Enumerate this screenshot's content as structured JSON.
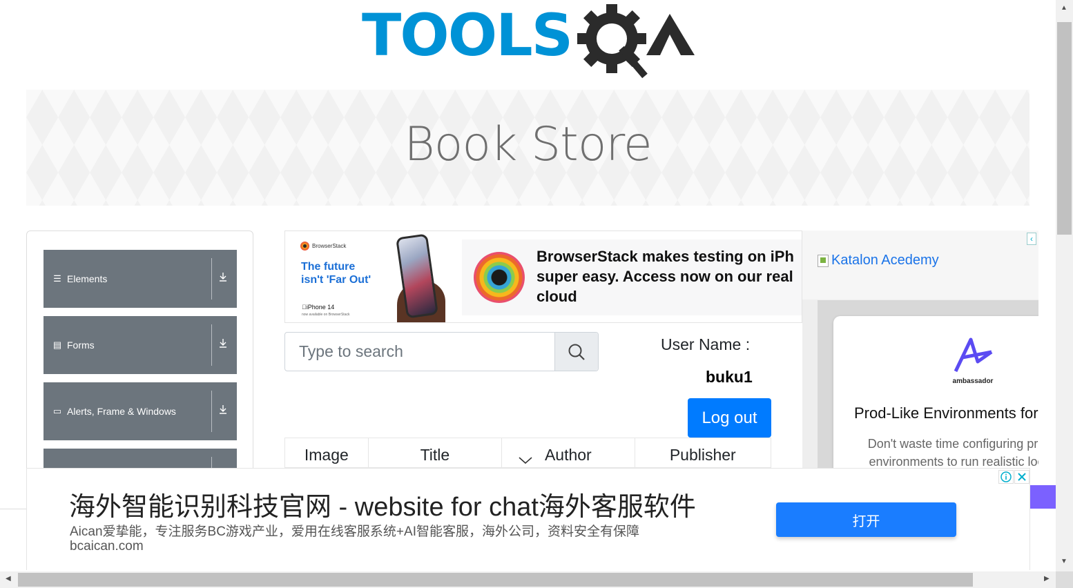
{
  "logo": {
    "text_main": "TOOLS",
    "text_q": "Q",
    "text_a": "A",
    "colors": {
      "blue": "#0092d6",
      "dark": "#2b2b2b"
    }
  },
  "banner": {
    "title": "Book Store"
  },
  "sidebar": {
    "groups": [
      {
        "label": "Elements",
        "icon": "hamburger-icon"
      },
      {
        "label": "Forms",
        "icon": "form-icon"
      },
      {
        "label": "Alerts, Frame & Windows",
        "icon": "window-icon"
      },
      {
        "label": "",
        "icon": ""
      }
    ]
  },
  "top_ad": {
    "brand": "BrowserStack",
    "tagline_1": "The future",
    "tagline_2": "isn't 'Far Out'",
    "device": "iPhone 14",
    "device_sub": "now available on BrowserStack",
    "headline_1": "BrowserStack makes testing on iPh",
    "headline_2": "super easy. Access now on our real",
    "headline_3": "cloud"
  },
  "search": {
    "placeholder": "Type to search",
    "value": ""
  },
  "user": {
    "label": "User Name :",
    "value": "buku1",
    "logout_label": "Log out"
  },
  "table": {
    "headers": [
      "Image",
      "Title",
      "Author",
      "Publisher"
    ]
  },
  "side_ad": {
    "katalon_alt": "Katalon Acedemy",
    "brand": "ambassador",
    "title": "Prod-Like Environments for",
    "body_1": "Don't waste time configuring prod",
    "body_2": "environments to run realistic loca"
  },
  "bottom_ad": {
    "headline": "海外智能识别科技官网 - website for chat海外客服软件",
    "description": "Aican爱挚能，专注服务BC游戏产业，爱用在线客服系统+AI智能客服，海外公司，资料安全有保障",
    "url": "bcaican.com",
    "button": "打开"
  },
  "colors": {
    "accent": "#007bff",
    "sidebar_bg": "#6c757d",
    "ad_button": "#1a7dff"
  }
}
